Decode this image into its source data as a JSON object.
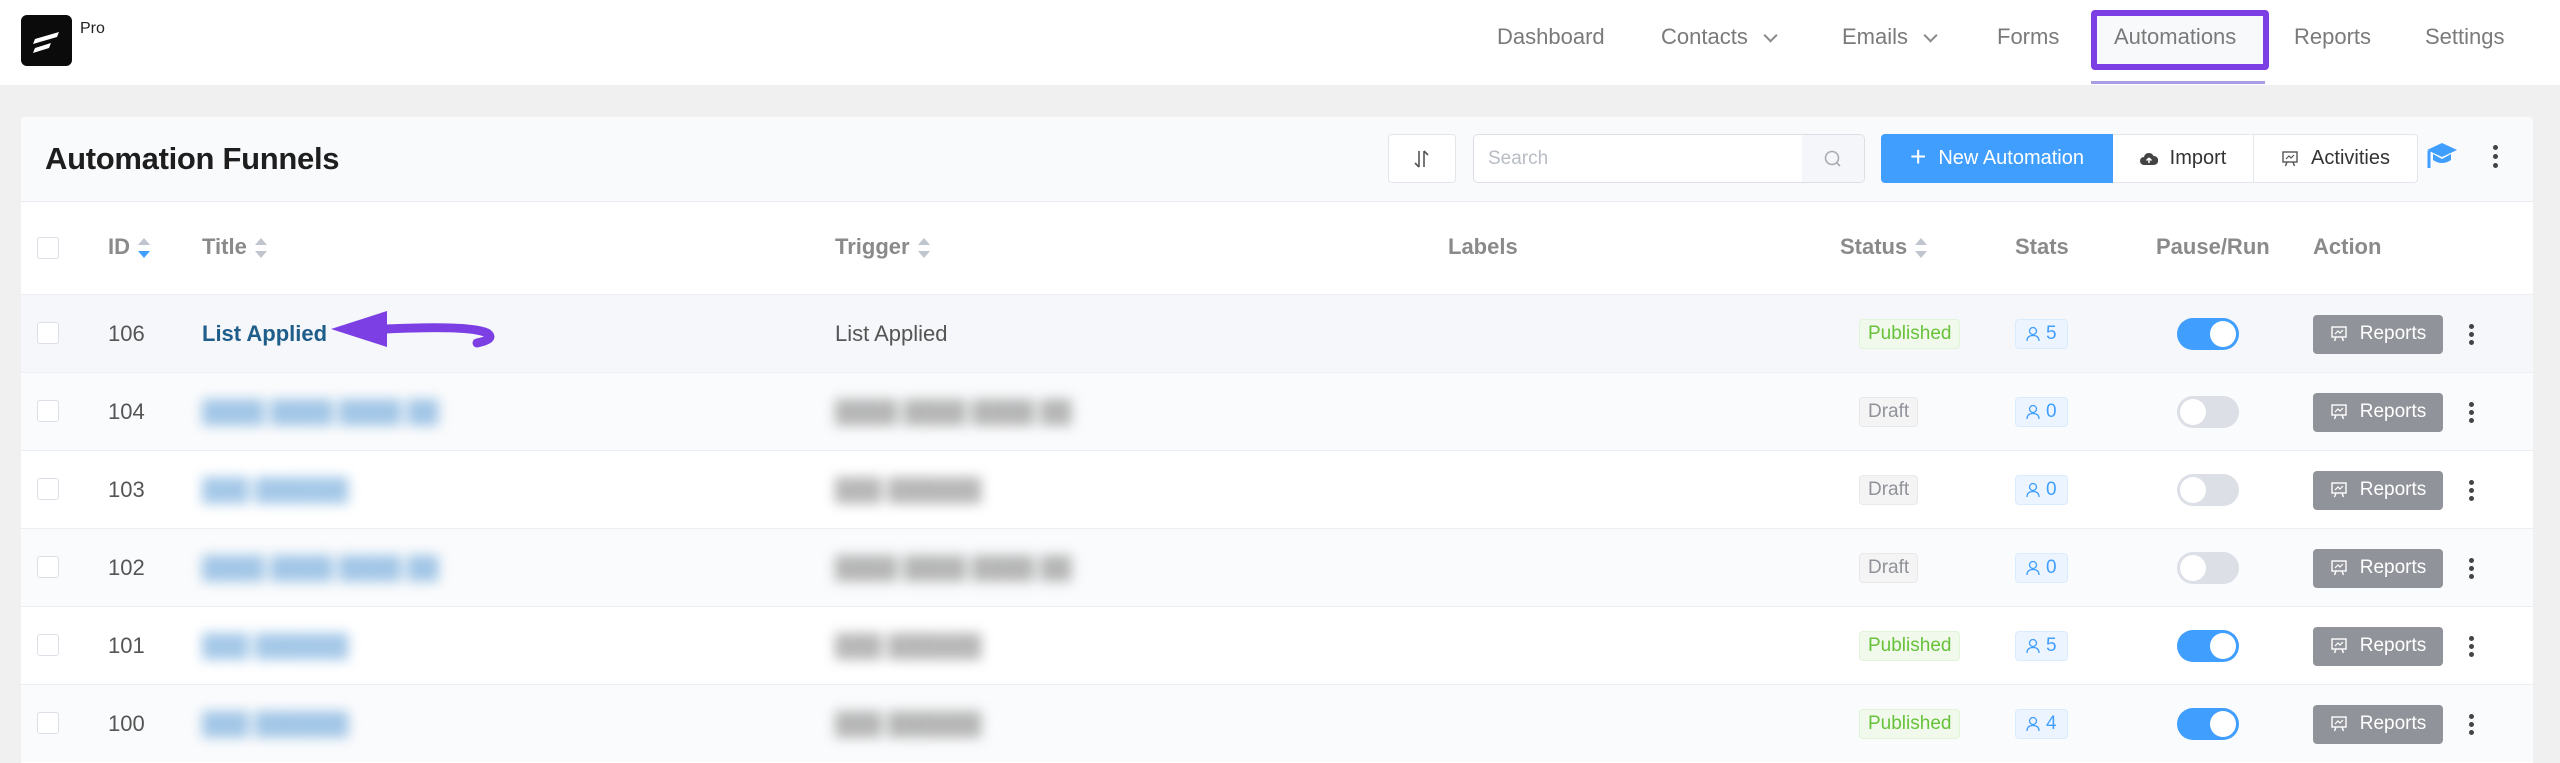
{
  "app": {
    "badge": "Pro"
  },
  "nav": {
    "items": [
      {
        "label": "Dashboard",
        "dropdown": false
      },
      {
        "label": "Contacts",
        "dropdown": true
      },
      {
        "label": "Emails",
        "dropdown": true
      },
      {
        "label": "Forms",
        "dropdown": false
      },
      {
        "label": "Automations",
        "dropdown": false,
        "active": true
      },
      {
        "label": "Reports",
        "dropdown": false
      },
      {
        "label": "Settings",
        "dropdown": false
      }
    ]
  },
  "header": {
    "title": "Automation Funnels",
    "search_placeholder": "Search",
    "search_value": "",
    "new_automation_label": "New Automation",
    "import_label": "Import",
    "activities_label": "Activities"
  },
  "table": {
    "columns": {
      "id": "ID",
      "title": "Title",
      "trigger": "Trigger",
      "labels": "Labels",
      "status": "Status",
      "stats": "Stats",
      "pause_run": "Pause/Run",
      "action": "Action"
    },
    "action_button_label": "Reports",
    "rows": [
      {
        "id": "106",
        "title": "List Applied",
        "trigger": "List Applied",
        "blurred": false,
        "status": "Published",
        "stats": "5",
        "running": true
      },
      {
        "id": "104",
        "title": "████ ████ ████ ██",
        "trigger": "████ ████ ████ ██",
        "blurred": true,
        "status": "Draft",
        "stats": "0",
        "running": false
      },
      {
        "id": "103",
        "title": "███ ██████",
        "trigger": "███ ██████",
        "blurred": true,
        "status": "Draft",
        "stats": "0",
        "running": false
      },
      {
        "id": "102",
        "title": "████ ████ ████ ██",
        "trigger": "████ ████ ████ ██",
        "blurred": true,
        "status": "Draft",
        "stats": "0",
        "running": false
      },
      {
        "id": "101",
        "title": "███ ██████",
        "trigger": "███ ██████",
        "blurred": true,
        "status": "Published",
        "stats": "5",
        "running": true
      },
      {
        "id": "100",
        "title": "███ ██████",
        "trigger": "███ ██████",
        "blurred": true,
        "status": "Published",
        "stats": "4",
        "running": true
      }
    ]
  },
  "colors": {
    "accent": "#409eff",
    "highlight": "#7b3fe4",
    "published": "#67c23a",
    "draft": "#909399",
    "link": "#1f5d8a"
  }
}
